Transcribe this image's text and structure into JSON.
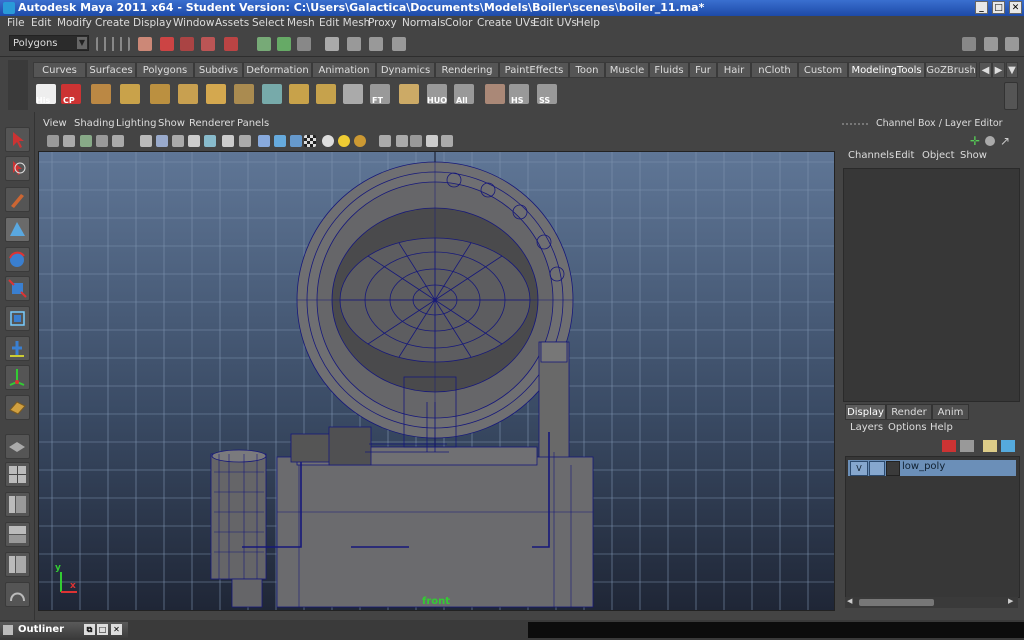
{
  "window": {
    "title": "Autodesk Maya 2011 x64 - Student Version: C:\\Users\\Galactica\\Documents\\Models\\Boiler\\scenes\\boiler_11.ma*",
    "minimize": "_",
    "maximize": "□",
    "close": "✕"
  },
  "menubar": [
    "File",
    "Edit",
    "Modify",
    "Create",
    "Display",
    "Window",
    "Assets",
    "Select",
    "Mesh",
    "Edit Mesh",
    "Proxy",
    "Normals",
    "Color",
    "Create UVs",
    "Edit UVs",
    "Help"
  ],
  "statusline": {
    "mode": "Polygons"
  },
  "shelf": {
    "tabs": [
      "Curves",
      "Surfaces",
      "Polygons",
      "Subdivs",
      "Deformation",
      "Animation",
      "Dynamics",
      "Rendering",
      "PaintEffects",
      "Toon",
      "Muscle",
      "Fluids",
      "Fur",
      "Hair",
      "nCloth",
      "Custom",
      "ModelingTools",
      "GoZBrush"
    ],
    "active_tab": "ModelingTools",
    "icon_labels": [
      "His",
      "CP",
      "FT",
      "HUO",
      "All",
      "HS",
      "SS"
    ]
  },
  "viewport": {
    "menu": [
      "View",
      "Shading",
      "Lighting",
      "Show",
      "Renderer",
      "Panels"
    ],
    "camera_label": "front",
    "axis_y": "y",
    "axis_x": "x"
  },
  "channel_box": {
    "header": "Channel Box / Layer Editor",
    "menu": [
      "Channels",
      "Edit",
      "Object",
      "Show"
    ]
  },
  "layer_editor": {
    "tabs": [
      "Display",
      "Render",
      "Anim"
    ],
    "active_tab": "Display",
    "menu": [
      "Layers",
      "Options",
      "Help"
    ],
    "layers": [
      {
        "visible": "V",
        "name": "low_poly"
      }
    ]
  },
  "bottom": {
    "outliner": "Outliner"
  },
  "colors": {
    "accent": "#3a6fcf",
    "wire": "#16187a",
    "viewport_top": "#5f7696",
    "viewport_bottom": "#1f2636"
  }
}
